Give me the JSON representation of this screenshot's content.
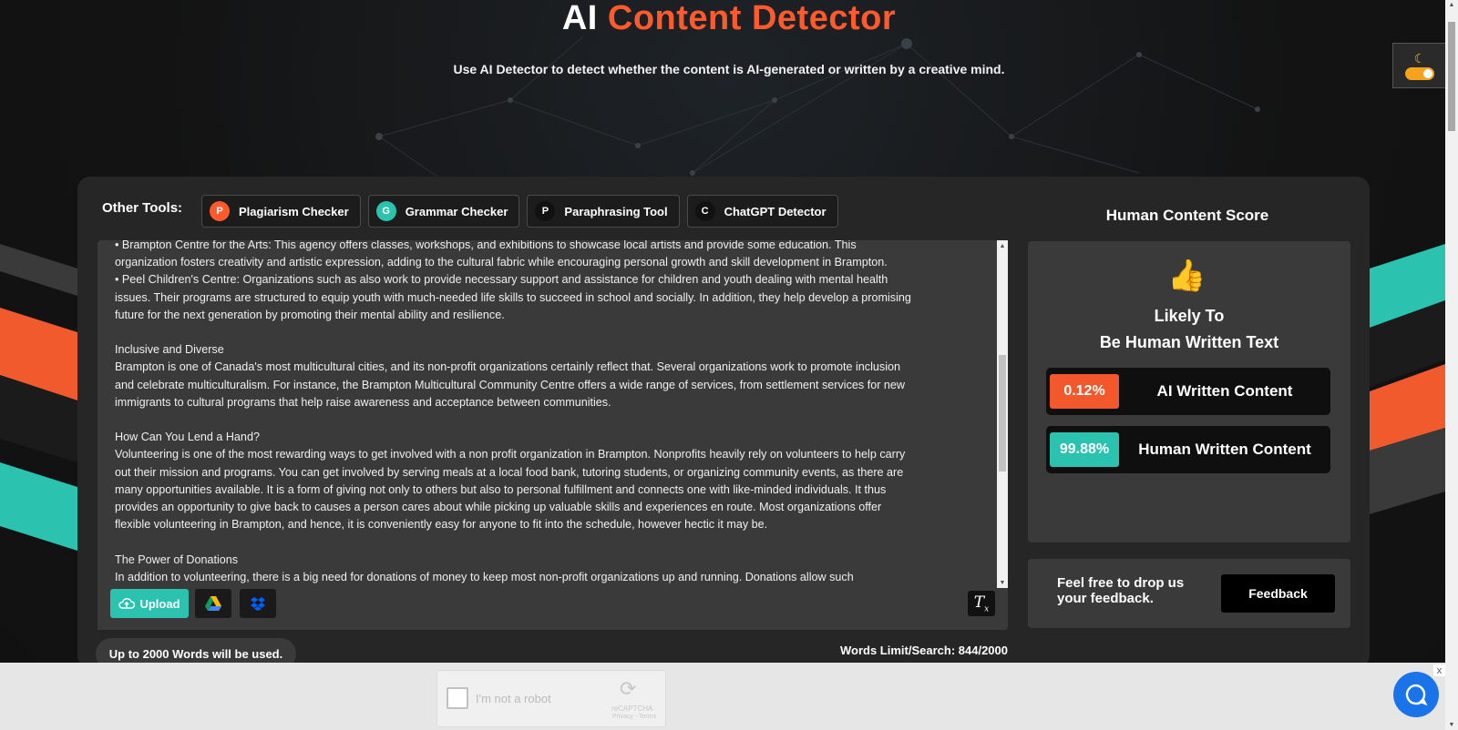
{
  "header": {
    "title_part1": "AI",
    "title_part2": "Content Detector",
    "subtitle": "Use AI Detector to detect whether the content is AI-generated or written by a creative mind."
  },
  "theme_toggle": {
    "icon": "moon-icon",
    "state": "dark"
  },
  "other_tools": {
    "label": "Other Tools:",
    "items": [
      {
        "initial": "P",
        "label": "Plagiarism Checker",
        "color": "#ff5a2c"
      },
      {
        "initial": "G",
        "label": "Grammar Checker",
        "color": "#2cc2b0"
      },
      {
        "initial": "P",
        "label": "Paraphrasing Tool",
        "color": "#111111"
      },
      {
        "initial": "C",
        "label": "ChatGPT Detector",
        "color": "#111111"
      }
    ]
  },
  "editor": {
    "lines": [
      "•      Brampton Centre for the Arts: This agency offers classes, workshops, and exhibitions to showcase local artists and provide some education. This",
      "organization fosters creativity and artistic expression, adding to the cultural fabric while encouraging personal growth and skill development in Brampton.",
      "•      Peel Children's Centre:  Organizations such as also work to provide necessary support and assistance for children and youth dealing with mental health",
      "issues. Their programs are structured to equip youth with much-needed life skills to succeed in school and socially. In addition, they help develop a promising",
      "future for the next generation by promoting their mental ability and resilience.",
      "",
      "Inclusive and Diverse",
      "Brampton is one of Canada's most multicultural cities, and its non-profit organizations certainly reflect that. Several organizations work to promote inclusion",
      "and celebrate multiculturalism. For instance, the Brampton Multicultural Community Centre offers a wide range of services, from settlement services for new",
      "immigrants to cultural programs that help raise awareness and acceptance between communities.",
      "",
      "How Can You Lend a Hand?",
      "Volunteering is one of the most rewarding ways to get involved with a non profit organization in Brampton. Nonprofits heavily rely on volunteers to help carry",
      "out their mission and programs. You can get involved by serving meals at a local food bank, tutoring students, or organizing community events, as there are",
      "many opportunities available. It is a form of giving not only to others but also to personal fulfillment and connects one with like-minded individuals. It thus",
      "provides an opportunity to give back to causes a person cares about while picking up valuable skills and experiences en route. Most organizations offer",
      "flexible volunteering in Brampton, and hence, it is conveniently easy for anyone to fit into the schedule, however hectic it may be.",
      "",
      "The Power of Donations",
      "In addition to volunteering, there is a big need for donations of money to keep most non-profit organizations up and running. Donations allow such"
    ],
    "upload_label": "Upload",
    "google_drive_icon": "google-drive-icon",
    "dropbox_icon": "dropbox-icon",
    "clear_icon": "clear-format-icon"
  },
  "words_note": "Up to 2000 Words will be used.",
  "word_limit": "Words Limit/Search: 844/2000",
  "score": {
    "title": "Human Content Score",
    "icon": "thumbs-up-icon",
    "verdict_line1": "Likely To",
    "verdict_line2": "Be Human Written Text",
    "ai": {
      "percent": "0.12%",
      "label": "AI Written Content"
    },
    "human": {
      "percent": "99.88%",
      "label": "Human Written Content"
    }
  },
  "feedback": {
    "text": "Feel free to drop us your feedback.",
    "button": "Feedback"
  },
  "captcha": {
    "label": "I'm not a robot",
    "brand": "reCAPTCHA",
    "links": "Privacy - Terms"
  },
  "ad_close": "x",
  "colors": {
    "accent": "#ff5a2c",
    "teal": "#2cc2b0",
    "panel": "#262626"
  }
}
